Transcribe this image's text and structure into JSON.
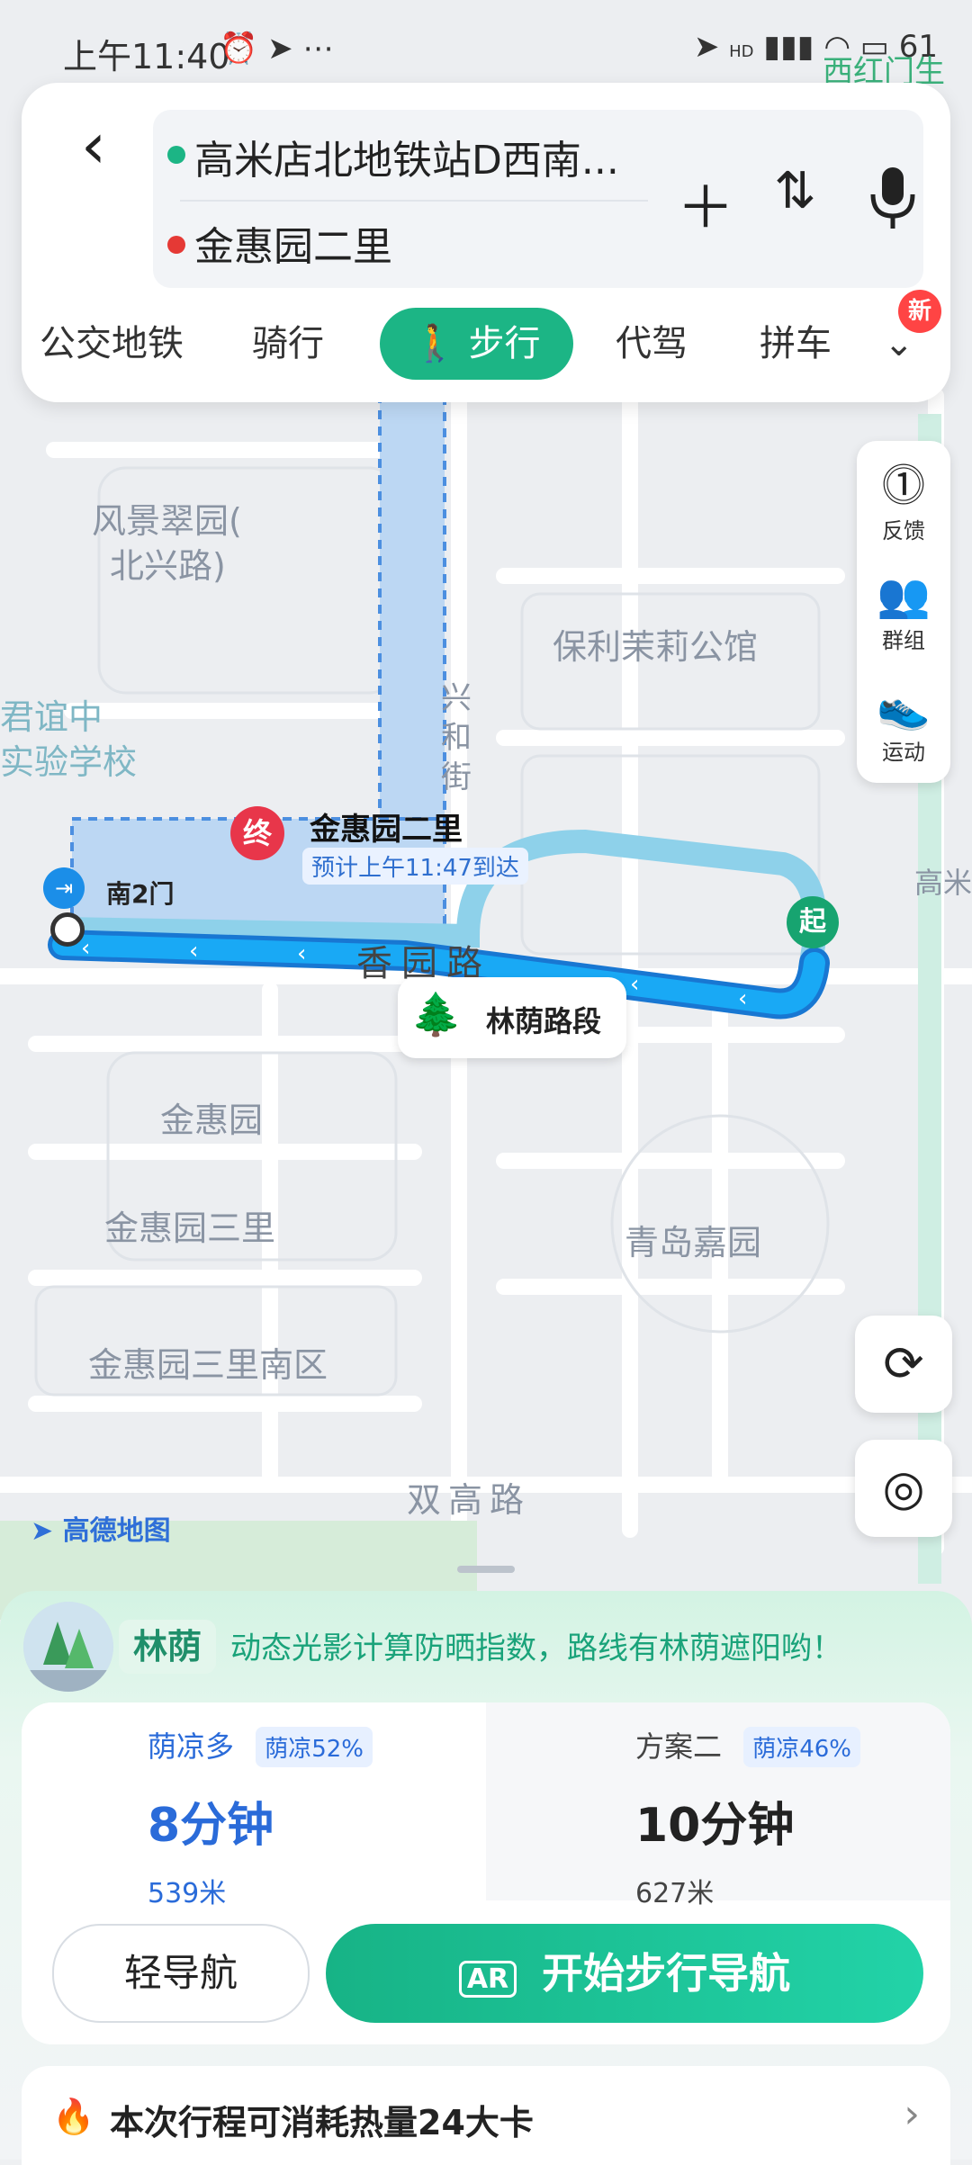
{
  "status_bar": {
    "time": "上午11:40",
    "right": "HD",
    "battery": "61",
    "behind_text": "西红门生态"
  },
  "search": {
    "back_icon": "back-chevron-icon",
    "origin": "高米店北地铁站D西南...",
    "destination": "金惠园二里",
    "add_icon": "plus-icon",
    "swap_icon": "swap-icon",
    "voice_icon": "microphone-icon",
    "origin_color": "#1cb585",
    "destination_color": "#e53935"
  },
  "tabs": [
    {
      "label": "公交地铁"
    },
    {
      "label": "骑行"
    },
    {
      "label": "步行",
      "active": true
    },
    {
      "label": "代驾"
    },
    {
      "label": "拼车"
    }
  ],
  "tabs_more_badge": "新",
  "map": {
    "labels": {
      "fengjing": "风景翠园(",
      "fengjing2": "北兴路)",
      "junyi": "君谊中",
      "school": "实验学校",
      "baoli": "保利茉莉公馆",
      "xinghe": "兴",
      "xinghe2": "和",
      "xinghe3": "街",
      "jinhuiyuan": "金惠园",
      "jinhui3": "金惠园三里",
      "jinhui3s": "金惠园三里南区",
      "qingdao": "青岛嘉园",
      "shuanggao": "双高路",
      "road": "香园路",
      "gao": "高米"
    },
    "destination_name": "金惠园二里",
    "eta": "预计上午11:47到达",
    "end_marker": "终",
    "start_marker": "起",
    "gate": "南2门",
    "shade_segment": "林荫路段",
    "brand": "高德地图"
  },
  "tools": [
    {
      "icon": "feedback-icon",
      "label": "反馈"
    },
    {
      "icon": "group-icon",
      "label": "群组"
    },
    {
      "icon": "sport-icon",
      "label": "运动"
    }
  ],
  "map_buttons": {
    "refresh_icon": "refresh-icon",
    "locate_icon": "locate-icon"
  },
  "shade_banner": {
    "tag": "林荫",
    "text": "动态光影计算防晒指数，路线有林荫遮阳哟！"
  },
  "plans": [
    {
      "title": "荫凉多",
      "tag": "荫凉52%",
      "time": "8分钟",
      "distance": "539米",
      "selected": true
    },
    {
      "title": "方案二",
      "tag": "荫凉46%",
      "time": "10分钟",
      "distance": "627米",
      "selected": false
    }
  ],
  "actions": {
    "light_nav": "轻导航",
    "start_nav": "开始步行导航",
    "ar_icon": "AR"
  },
  "calorie": {
    "text": "本次行程可消耗热量24大卡",
    "chevron_icon": "chevron-right-icon"
  }
}
